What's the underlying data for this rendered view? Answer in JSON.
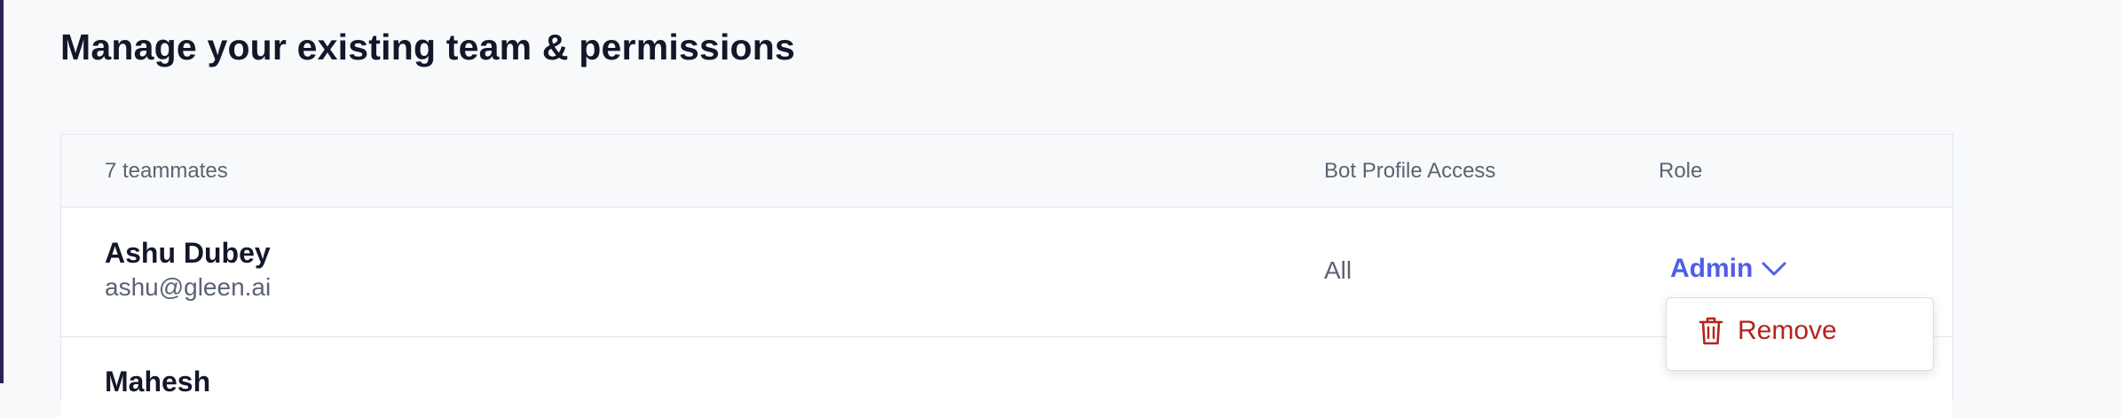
{
  "page": {
    "title": "Manage your existing team & permissions"
  },
  "table": {
    "headers": {
      "members": "7 teammates",
      "bot_access": "Bot Profile Access",
      "role": "Role"
    },
    "rows": [
      {
        "name": "Ashu Dubey",
        "email": "ashu@gleen.ai",
        "bot_access": "All",
        "role": "Admin"
      },
      {
        "name": "Mahesh"
      }
    ]
  },
  "role_menu": {
    "remove_label": "Remove",
    "remove_icon": "trash-icon"
  },
  "colors": {
    "accent": "#4f5de8",
    "danger": "#b5221b",
    "sidebar_edge": "#2a2359"
  }
}
